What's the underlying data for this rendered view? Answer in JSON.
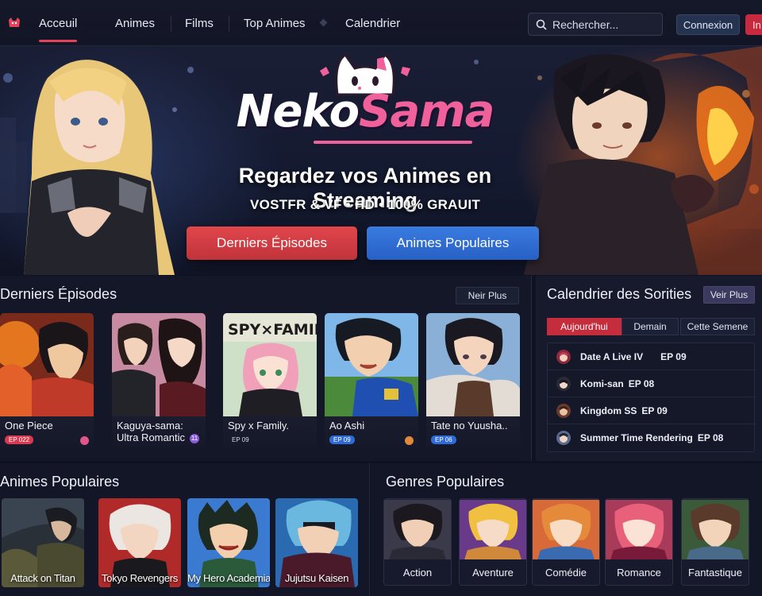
{
  "nav": {
    "items": [
      {
        "label": "Acceuil",
        "active": true
      },
      {
        "label": "Animes",
        "active": false
      },
      {
        "label": "Films",
        "active": false
      },
      {
        "label": "Top Animes",
        "active": false
      },
      {
        "label": "Calendrier",
        "active": false
      }
    ],
    "search_placeholder": "Rechercher...",
    "login_label": "Connexion",
    "signup_label": "In"
  },
  "hero": {
    "brand_part1": "Neko",
    "brand_part2": "Sama",
    "headline": "Regardez vos Animes en Streaming",
    "subline": "VOSTFR & VF • HD • 100% GRAUIT",
    "btn_latest": "Derniers Épisodes",
    "btn_popular": "Animes Populaires"
  },
  "latest": {
    "title": "Derniers Épisodes",
    "more_label": "Neir Plus",
    "episodes": [
      {
        "title": "One Piece",
        "title2": "",
        "badge": "EP 022",
        "badge_style": "red",
        "mark_color": "#e0568a"
      },
      {
        "title": "Kaguya-sama:",
        "title2": "Ultra Romantic",
        "badge": "11",
        "badge_style": "dark",
        "mark_color": "#8b5ad6"
      },
      {
        "title": "Spy x Family.",
        "title2": "",
        "badge": "EP 09",
        "badge_style": "dark",
        "mark_color": ""
      },
      {
        "title": "Ao Ashi",
        "title2": "",
        "badge": "EP 09",
        "badge_style": "blue",
        "mark_color": "#e08a3a"
      },
      {
        "title": "Tate no Yuusha..",
        "title2": "",
        "badge": "EP 06",
        "badge_style": "blue",
        "mark_color": ""
      }
    ]
  },
  "calendar": {
    "title": "Calendrier des Sorities",
    "more_label": "Veir Plus",
    "tabs": [
      {
        "label": "Aujourd'hui",
        "active": true
      },
      {
        "label": "Demain",
        "active": false
      },
      {
        "label": "Cette Semene",
        "active": false
      }
    ],
    "entries": [
      {
        "name": "Date A Live IV",
        "episode": "EP 09"
      },
      {
        "name": "Komi-san",
        "episode": "EP 08"
      },
      {
        "name": "Kingdom SS",
        "episode": "EP 09"
      },
      {
        "name": "Summer Time Rendering",
        "episode": "EP 08"
      }
    ]
  },
  "popular": {
    "title": "Animes Populaires",
    "items": [
      {
        "label": "Attack on Titan"
      },
      {
        "label": "Tokyo Revengers"
      },
      {
        "label": "My Hero Academia"
      },
      {
        "label": "Jujutsu Kaisen"
      }
    ]
  },
  "genres": {
    "title": "Genres Populaires",
    "items": [
      {
        "label": "Action"
      },
      {
        "label": "Aventure"
      },
      {
        "label": "Comédie"
      },
      {
        "label": "Romance"
      },
      {
        "label": "Fantastique"
      }
    ]
  },
  "colors": {
    "accent_red": "#e5435c",
    "accent_blue": "#2f6fdc",
    "brand_pink": "#f0609a",
    "background": "#0f1220"
  }
}
